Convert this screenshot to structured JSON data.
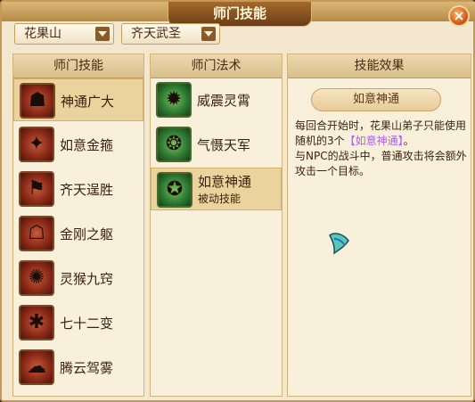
{
  "window": {
    "title": "师门技能",
    "close_icon": "close-icon"
  },
  "filters": {
    "sect": "花果山",
    "title": "齐天武圣"
  },
  "panels": {
    "skills_header": "师门技能",
    "spells_header": "师门法术",
    "effect_header": "技能效果"
  },
  "skills": [
    {
      "label": "神通广大",
      "icon": "monkey-mask-icon",
      "selected": true
    },
    {
      "label": "如意金箍",
      "icon": "staff-icon",
      "selected": false
    },
    {
      "label": "齐天逞胜",
      "icon": "flag-icon",
      "selected": false
    },
    {
      "label": "金刚之躯",
      "icon": "body-icon",
      "selected": false
    },
    {
      "label": "灵猴九窍",
      "icon": "monkey-icon",
      "selected": false
    },
    {
      "label": "七十二变",
      "icon": "bian-glyph-icon",
      "selected": false
    },
    {
      "label": "腾云驾雾",
      "icon": "cloud-icon",
      "selected": false
    }
  ],
  "spells": [
    {
      "label": "威震灵霄",
      "sub": "",
      "icon": "roar-icon",
      "selected": false
    },
    {
      "label": "气慑天军",
      "sub": "",
      "icon": "army-icon",
      "selected": false
    },
    {
      "label": "如意神通",
      "sub": "被动技能",
      "icon": "swirl-icon",
      "selected": true
    }
  ],
  "effect": {
    "name": "如意神通",
    "line1": "每回合开始时，花果山弟子只能使用随机的3个",
    "highlight": "【如意神通】",
    "line1_end": "。",
    "line2": "与NPC的战斗中，普通攻击将会额外攻击一个目标。"
  },
  "colors": {
    "highlight": "#b05aff",
    "accent": "#b58a45"
  }
}
